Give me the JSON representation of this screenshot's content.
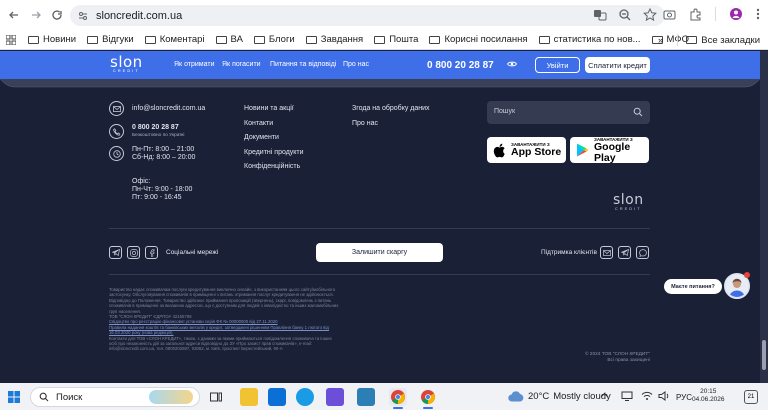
{
  "browser": {
    "url": "sloncredit.com.ua",
    "bookmarks": [
      "Новини",
      "Відгуки",
      "Коментарі",
      "ВА",
      "Блоги",
      "Завдання",
      "Пошта",
      "Корисні посилання",
      "статистика по нов...",
      "МФО"
    ],
    "all_bookmarks_label": "Все закладки",
    "more_label": "»"
  },
  "header": {
    "logo": "slon",
    "logo_sub": "CREDIT",
    "nav": [
      "Як отримати",
      "Як погасити",
      "Питання та відповіді",
      "Про нас"
    ],
    "phone": "0 800 20 28 87",
    "login_label": "Увійти",
    "pay_label": "Сплатити кредит"
  },
  "footer": {
    "email": "info@sloncredit.com.ua",
    "phone": "0 800 20 28 87",
    "phone_note": "Безкоштовно по Україні",
    "hours_weekday": "Пн-Пт: 8:00 – 21:00",
    "hours_weekend": "Сб-Нд: 8:00 – 20:00",
    "office_title": "Офіс:",
    "office_weekday": "Пн-Чт: 9:00 - 18:00",
    "office_friday": "Пт: 9:00 - 16:45",
    "links_col1": [
      "Новини та акції",
      "Контакти",
      "Документи",
      "Кредитні продукти",
      "Конфіденційність"
    ],
    "links_col2": [
      "Згода на обробку даних",
      "Про нас"
    ],
    "search_placeholder": "Пошук",
    "app_store_small": "ЗАВАНТАЖИТИ З",
    "app_store_big": "App Store",
    "google_play_small": "ЗАВАНТАЖИТИ З",
    "google_play_big": "Google Play",
    "logo": "slon",
    "logo_sub": "CREDIT",
    "social_label": "Соціальні мережі",
    "complaint_label": "Залишити скаргу",
    "support_label": "Підтримка клієнтів",
    "legal_lines": [
      "Товариство надає споживачам послуги кредитування виключно онлайн, з використанням цього сайту/мобільного",
      "застосунку. Обслуговування споживачів в приміщенні з питань отримання послуг кредитування не здійснюється.",
      "Відповідно до Положення. Товариство здійснює приймання пропозицій (звернень), скарг, повідомлень з питань",
      "споживачів в приміщенні за вказаною адресою, що є доступним для людей з інвалідністю та інших маломобільних",
      "груп населення.",
      "ТОВ \"СЛОН КРЕДИТ\" ЄДРПОУ 42155786",
      "Свідоцтво про реєстрацію фінансової установи серія ФК № 00000000 від 27.11.2020",
      "Правила надання коштів та банківських металів у кредит, затверджені рішенням Правління банку 1 лютого від",
      "16.03.2020 року (нова редакція).",
      "Контакти для ТОВ «СЛОН КРЕДИТ», також, з даними за якими приймаються повідомлення споживача та інших",
      "осіб про незаконність дій за загальної адреси відповідно до ЗУ «Про захист прав споживачів», e-mail:",
      "info@sloncredit.com.ua, тел. 0800202887, 03062, м. Київ, проспект Берестейський, 90-А"
    ],
    "copyright_line1": "© 2024 ТОВ \"СЛОН КРЕДИТ\"",
    "copyright_line2": "Всі права захищені"
  },
  "chat": {
    "label": "Маєте питання?"
  },
  "taskbar": {
    "search_placeholder": "Поиск",
    "temperature": "20°C",
    "weather_text": "Mostly cloudy",
    "language": "РУС",
    "time": "20:15",
    "date": "04.06.2026",
    "notification_count": "21"
  },
  "colors": {
    "brand_blue": "#3f6fe8",
    "footer_bg": "#1a2036",
    "text_light": "#e2e5ee"
  }
}
